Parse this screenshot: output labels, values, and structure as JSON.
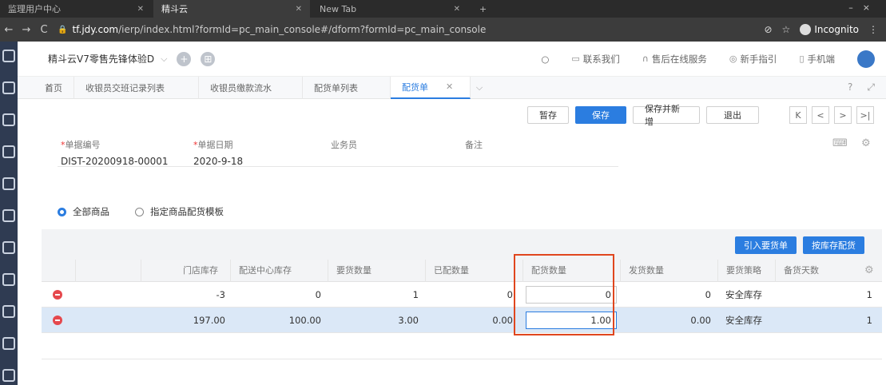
{
  "browser": {
    "tabs": [
      {
        "label": "监理用户中心",
        "active": false
      },
      {
        "label": "精斗云",
        "active": true
      },
      {
        "label": "New Tab",
        "active": false
      }
    ],
    "url_host": "tf.jdy.com",
    "url_path": "/ierp/index.html?formId=pc_main_console#/dform?formId=pc_main_console",
    "incognito_label": "Incognito"
  },
  "app": {
    "name": "精斗云V7零售先锋体验D",
    "header_links": [
      "联系我们",
      "售后在线服务",
      "新手指引",
      "手机端"
    ]
  },
  "page_tabs": [
    {
      "label": "首页",
      "active": false
    },
    {
      "label": "收银员交班记录列表",
      "active": false
    },
    {
      "label": "收银员缴款流水",
      "active": false
    },
    {
      "label": "配货单列表",
      "active": false
    },
    {
      "label": "配货单",
      "active": true
    }
  ],
  "toolbar": {
    "save_draft": "暂存",
    "save": "保存",
    "save_new": "保存并新增",
    "exit": "退出",
    "pager": [
      "K",
      "<",
      ">",
      ">|"
    ]
  },
  "form": {
    "doc_no_label": "单据编号",
    "doc_no": "DIST-20200918-00001",
    "date_label": "单据日期",
    "date": "2020-9-18",
    "salesman_label": "业务员",
    "salesman": "",
    "remark_label": "备注",
    "remark": ""
  },
  "radios": [
    {
      "label": "全部商品",
      "checked": true
    },
    {
      "label": "指定商品配货模板",
      "checked": false
    }
  ],
  "grid_buttons": [
    "引入要货单",
    "按库存配货"
  ],
  "grid": {
    "headers": [
      "门店库存",
      "配送中心库存",
      "要货数量",
      "已配数量",
      "配货数量",
      "发货数量",
      "要货策略",
      "备货天数"
    ],
    "rows": [
      {
        "store_stock": "-3",
        "dc_stock": "0",
        "req_qty": "1",
        "allocated": "0",
        "dist_qty": "0",
        "ship_qty": "0",
        "strategy": "安全库存",
        "days": "1",
        "selected": false
      },
      {
        "store_stock": "197.00",
        "dc_stock": "100.00",
        "req_qty": "3.00",
        "allocated": "0.00",
        "dist_qty": "1.00",
        "ship_qty": "0.00",
        "strategy": "安全库存",
        "days": "1",
        "selected": true
      }
    ]
  },
  "colors": {
    "accent": "#2b7de0",
    "highlight_box": "#e0461e",
    "delete": "#e5484d"
  }
}
